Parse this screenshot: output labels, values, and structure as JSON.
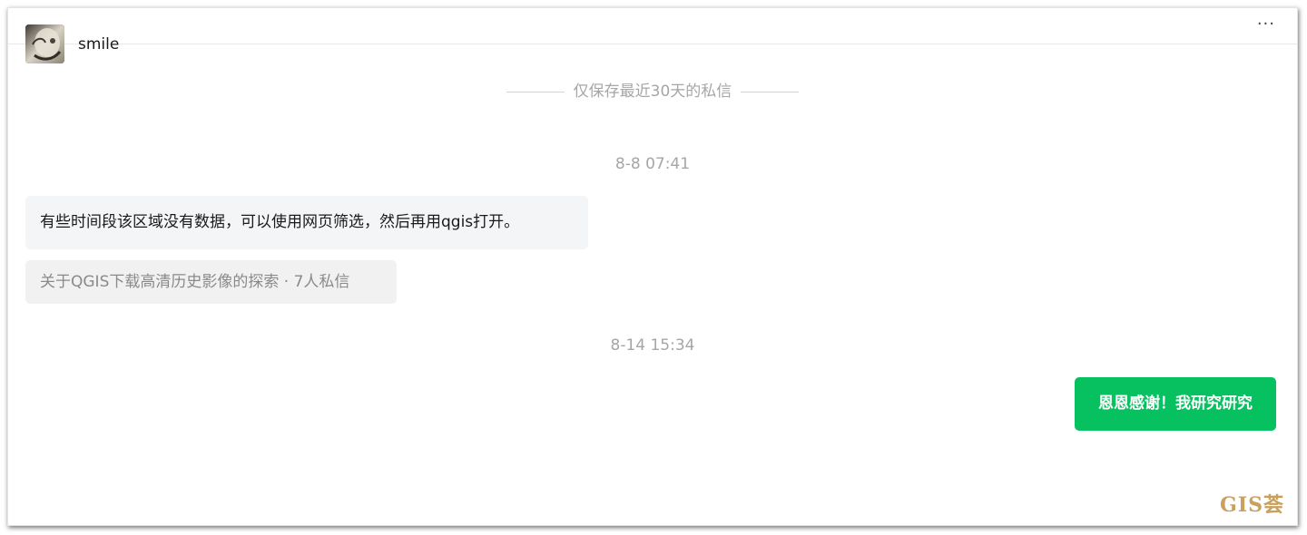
{
  "header": {
    "username": "smile",
    "more_label": "···",
    "avatar_icon": "user-avatar"
  },
  "notice": {
    "text": "仅保存最近30天的私信"
  },
  "conversation": {
    "groups": [
      {
        "timestamp": "8-8 07:41",
        "messages": [
          {
            "side": "left",
            "text": "有些时间段该区域没有数据，可以使用网页筛选，然后再用qgis打开。"
          },
          {
            "side": "left",
            "type": "link-card",
            "text": "关于QGIS下载高清历史影像的探索 · 7人私信"
          }
        ]
      },
      {
        "timestamp": "8-14 15:34",
        "messages": [
          {
            "side": "right",
            "text": "恩恩感谢！我研究研究"
          }
        ]
      }
    ]
  },
  "watermark": {
    "text": "GIS荟"
  },
  "colors": {
    "accent_green": "#07c160",
    "bubble_gray": "#f4f5f7",
    "meta_gray": "#a6a6a6",
    "watermark_gold": "#c9a05c"
  }
}
